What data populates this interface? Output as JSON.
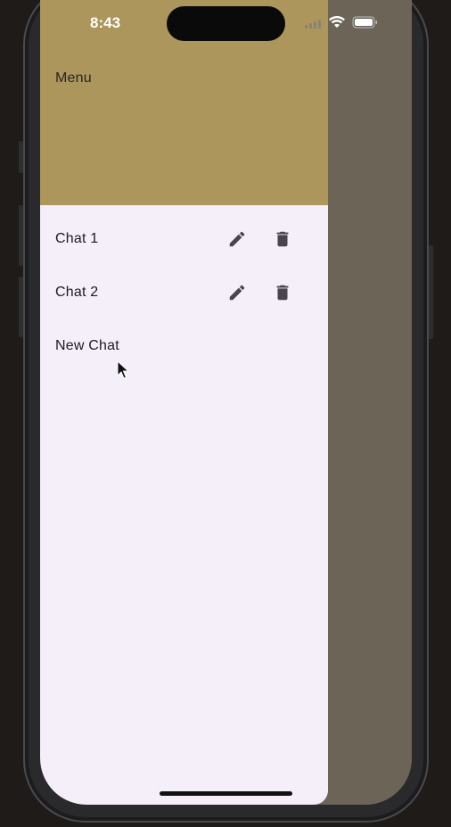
{
  "status_bar": {
    "time": "8:43",
    "icons": [
      "signal-icon",
      "wifi-icon",
      "battery-icon"
    ]
  },
  "drawer": {
    "header_title": "Menu",
    "header_color": "#ac965c",
    "background_color": "#f4eff8",
    "items": [
      {
        "label": "Chat 1",
        "actions": [
          "edit-icon",
          "delete-icon"
        ]
      },
      {
        "label": "Chat 2",
        "actions": [
          "edit-icon",
          "delete-icon"
        ]
      },
      {
        "label": "New Chat",
        "actions": []
      }
    ]
  },
  "scrim_color": "#6b6457"
}
